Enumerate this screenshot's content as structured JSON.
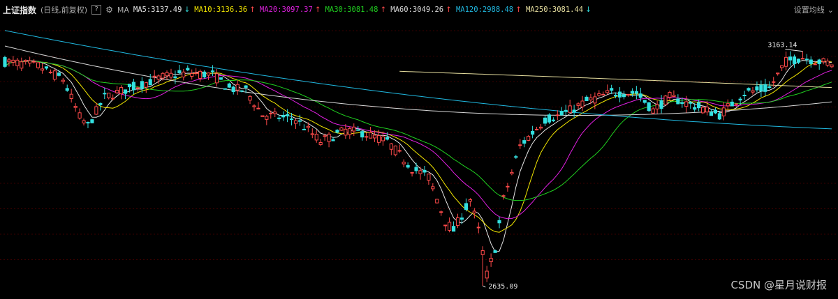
{
  "header": {
    "title": "上证指数",
    "period": "(日线,前复权)",
    "help_icon": "?",
    "settings_icon": "gear-icon",
    "ma_label": "MA",
    "ma_items": [
      {
        "name": "MA5",
        "value": "3137.49",
        "dir": "down",
        "color": "#e6e6e6"
      },
      {
        "name": "MA10",
        "value": "3136.36",
        "dir": "up",
        "color": "#f2e600"
      },
      {
        "name": "MA20",
        "value": "3097.37",
        "dir": "up",
        "color": "#e020e0"
      },
      {
        "name": "MA30",
        "value": "3081.48",
        "dir": "up",
        "color": "#20d020"
      },
      {
        "name": "MA60",
        "value": "3049.26",
        "dir": "up",
        "color": "#d8d8d8"
      },
      {
        "name": "MA120",
        "value": "2988.48",
        "dir": "up",
        "color": "#20b8e0"
      },
      {
        "name": "MA250",
        "value": "3081.44",
        "dir": "down",
        "color": "#e8e0a0"
      }
    ],
    "settings_label": "设置均线"
  },
  "annotations": {
    "high": "3163.14",
    "low": "2635.09"
  },
  "watermark": "CSDN @星月说财报",
  "colors": {
    "background": "#000000",
    "grid": "#3a0000",
    "up": "#ff4a4a",
    "down": "#33e0e0"
  },
  "chart_data": {
    "type": "candlestick",
    "y_range": [
      2610,
      3230
    ],
    "grid": true,
    "marked_high": 3163.14,
    "marked_low": 2635.09,
    "moving_averages": [
      "MA5",
      "MA10",
      "MA20",
      "MA30",
      "MA60",
      "MA120",
      "MA250"
    ],
    "ma_last_values": [
      3137.49,
      3136.36,
      3097.37,
      3081.48,
      3049.26,
      2988.48,
      3081.44
    ]
  }
}
